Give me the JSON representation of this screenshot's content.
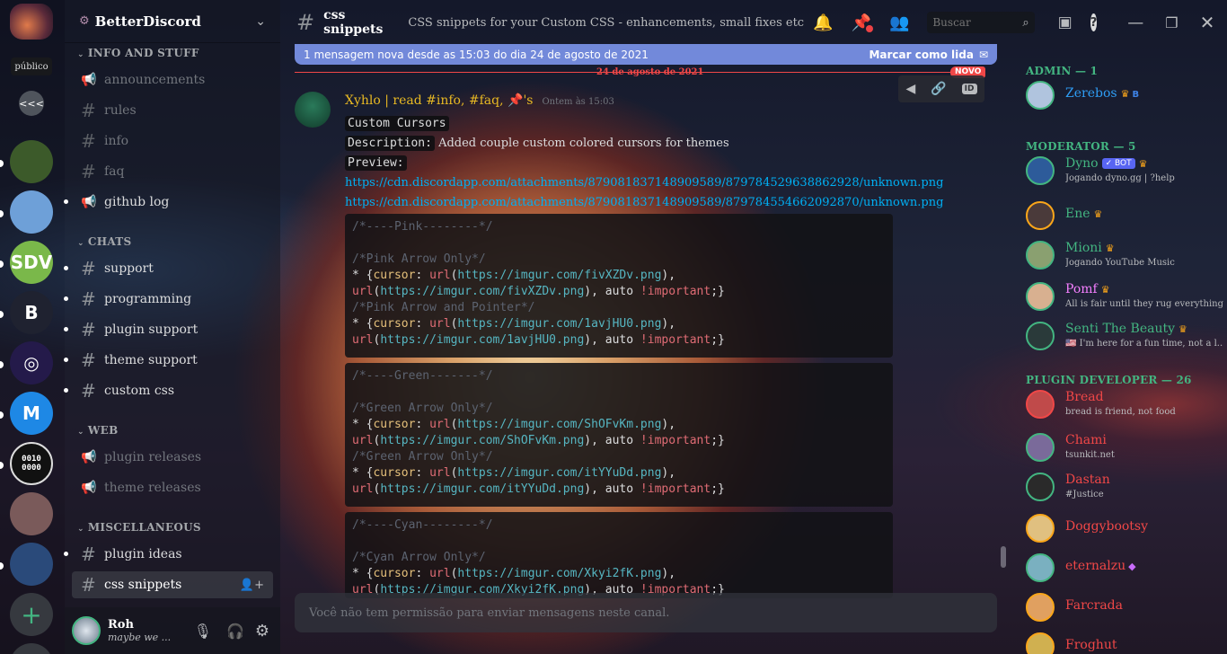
{
  "server": {
    "name": "BetterDiscord",
    "tooltip": "público",
    "collapse_label": "<<<",
    "add_icon": "plus-icon",
    "icons": [
      {
        "name": "server-space",
        "text": "",
        "color": "#5b3a4a"
      },
      {
        "name": "server-daisy",
        "text": "",
        "color": "#3c5a2a"
      },
      {
        "name": "server-bird",
        "text": "",
        "color": "#6ea0d8"
      },
      {
        "name": "server-sdv",
        "text": "SDV",
        "color": "#7ab84a"
      },
      {
        "name": "server-bd",
        "text": "B",
        "color": "#1f2230"
      },
      {
        "name": "server-spiral",
        "text": "◎",
        "color": "#241a4a"
      },
      {
        "name": "server-m",
        "text": "M",
        "color": "#1e88e5"
      },
      {
        "name": "server-binary",
        "text": "0010\n0000",
        "color": "#111"
      },
      {
        "name": "server-anime",
        "text": "",
        "color": "#7a5a5a"
      },
      {
        "name": "server-blue",
        "text": "",
        "color": "#2a4a7a"
      }
    ]
  },
  "sidebar": {
    "categories": [
      {
        "label": "INFO AND STUFF",
        "channels": [
          {
            "label": "announcements",
            "icon": "megaphone-icon",
            "muted": true
          },
          {
            "label": "rules",
            "icon": "hash-icon",
            "muted": true
          },
          {
            "label": "info",
            "icon": "hash-icon",
            "muted": true
          },
          {
            "label": "faq",
            "icon": "hash-icon",
            "muted": true
          },
          {
            "label": "github log",
            "icon": "megaphone-icon",
            "muted": false
          }
        ]
      },
      {
        "label": "CHATS",
        "channels": [
          {
            "label": "support",
            "icon": "hash-icon",
            "muted": false
          },
          {
            "label": "programming",
            "icon": "hash-icon",
            "muted": false
          },
          {
            "label": "plugin support",
            "icon": "hash-icon",
            "muted": false
          },
          {
            "label": "theme support",
            "icon": "hash-icon",
            "muted": false
          },
          {
            "label": "custom css",
            "icon": "hash-icon",
            "muted": false
          }
        ]
      },
      {
        "label": "WEB",
        "channels": [
          {
            "label": "plugin releases",
            "icon": "megaphone-icon",
            "muted": true
          },
          {
            "label": "theme releases",
            "icon": "megaphone-icon",
            "muted": true
          }
        ]
      },
      {
        "label": "MISCELLANEOUS",
        "channels": [
          {
            "label": "plugin ideas",
            "icon": "hash-icon",
            "muted": false
          },
          {
            "label": "css snippets",
            "icon": "hash-icon",
            "muted": false,
            "selected": true
          }
        ]
      }
    ]
  },
  "user_panel": {
    "name": "Roh",
    "status": "maybe we ..."
  },
  "header": {
    "channel": "css snippets",
    "topic": "CSS snippets for your Custom CSS - enhancements, small fixes etc",
    "search_placeholder": "Buscar"
  },
  "new_messages_bar": {
    "text": "1 mensagem nova desde as 15:03 do dia 24 de agosto de 2021",
    "action": "Marcar como lida"
  },
  "divider": {
    "date": "24 de agosto de 2021",
    "badge": "NOVO"
  },
  "message": {
    "author": "Xyhlo | read #info, #faq, 📌's",
    "timestamp": "Ontem às 15:03",
    "line1": "Custom Cursors",
    "line2_label": "Description:",
    "line2_text": "Added couple custom colored cursors for themes",
    "line3": "Preview:",
    "link1": "https://cdn.discordapp.com/attachments/879081837148909589/879784529638862928/unknown.png",
    "link2": "https://cdn.discordapp.com/attachments/879081837148909589/879784554662092870/unknown.png"
  },
  "code_blocks": [
    {
      "lines": [
        {
          "t": "/*----Pink--------*/",
          "c": "cm"
        },
        {
          "t": "",
          "c": ""
        },
        {
          "t": "/*Pink Arrow Only*/",
          "c": "cm"
        },
        {
          "t": "* {",
          "c": "mix",
          "parts": [
            [
              "* {",
              ""
            ],
            [
              "cursor",
              ":kw"
            ],
            [
              ": ",
              ""
            ],
            [
              "url",
              "fn"
            ],
            [
              "(",
              ""
            ],
            [
              "https://imgur.com/fivXZDv.png",
              "url"
            ],
            [
              "),",
              ""
            ]
          ]
        },
        {
          "t": "",
          "c": "mix",
          "parts": [
            [
              "url",
              "fn"
            ],
            [
              "(",
              ""
            ],
            [
              "https://imgur.com/fivXZDv.png",
              "url"
            ],
            [
              "), auto ",
              ""
            ],
            [
              "!important",
              "imp"
            ],
            [
              ";}",
              ""
            ]
          ]
        },
        {
          "t": "/*Pink Arrow and Pointer*/",
          "c": "cm"
        },
        {
          "t": "",
          "c": "mix",
          "parts": [
            [
              "* {",
              ""
            ],
            [
              "cursor",
              "kw"
            ],
            [
              ": ",
              ""
            ],
            [
              "url",
              "fn"
            ],
            [
              "(",
              ""
            ],
            [
              "https://imgur.com/1avjHU0.png",
              "url"
            ],
            [
              "),",
              ""
            ]
          ]
        },
        {
          "t": "",
          "c": "mix",
          "parts": [
            [
              "url",
              "fn"
            ],
            [
              "(",
              ""
            ],
            [
              "https://imgur.com/1avjHU0.png",
              "url"
            ],
            [
              "), auto ",
              ""
            ],
            [
              "!important",
              "imp"
            ],
            [
              ";}",
              ""
            ]
          ]
        }
      ]
    },
    {
      "lines": [
        {
          "t": "/*----Green-------*/",
          "c": "cm"
        },
        {
          "t": "",
          "c": ""
        },
        {
          "t": "/*Green Arrow Only*/",
          "c": "cm"
        },
        {
          "t": "",
          "c": "mix",
          "parts": [
            [
              "* {",
              ""
            ],
            [
              "cursor",
              "kw"
            ],
            [
              ": ",
              ""
            ],
            [
              "url",
              "fn"
            ],
            [
              "(",
              ""
            ],
            [
              "https://imgur.com/ShOFvKm.png",
              "url"
            ],
            [
              "),",
              ""
            ]
          ]
        },
        {
          "t": "",
          "c": "mix",
          "parts": [
            [
              "url",
              "fn"
            ],
            [
              "(",
              ""
            ],
            [
              "https://imgur.com/ShOFvKm.png",
              "url"
            ],
            [
              "), auto ",
              ""
            ],
            [
              "!important",
              "imp"
            ],
            [
              ";}",
              ""
            ]
          ]
        },
        {
          "t": "/*Green Arrow Only*/",
          "c": "cm"
        },
        {
          "t": "",
          "c": "mix",
          "parts": [
            [
              "* {",
              ""
            ],
            [
              "cursor",
              "kw"
            ],
            [
              ": ",
              ""
            ],
            [
              "url",
              "fn"
            ],
            [
              "(",
              ""
            ],
            [
              "https://imgur.com/itYYuDd.png",
              "url"
            ],
            [
              "),",
              ""
            ]
          ]
        },
        {
          "t": "",
          "c": "mix",
          "parts": [
            [
              "url",
              "fn"
            ],
            [
              "(",
              ""
            ],
            [
              "https://imgur.com/itYYuDd.png",
              "url"
            ],
            [
              "), auto ",
              ""
            ],
            [
              "!important",
              "imp"
            ],
            [
              ";}",
              ""
            ]
          ]
        }
      ]
    },
    {
      "lines": [
        {
          "t": "/*----Cyan--------*/",
          "c": "cm"
        },
        {
          "t": "",
          "c": ""
        },
        {
          "t": "/*Cyan Arrow Only*/",
          "c": "cm"
        },
        {
          "t": "",
          "c": "mix",
          "parts": [
            [
              "* {",
              ""
            ],
            [
              "cursor",
              "kw"
            ],
            [
              ": ",
              ""
            ],
            [
              "url",
              "fn"
            ],
            [
              "(",
              ""
            ],
            [
              "https://imgur.com/Xkyi2fK.png",
              "url"
            ],
            [
              "),",
              ""
            ]
          ]
        },
        {
          "t": "",
          "c": "mix",
          "parts": [
            [
              "url",
              "fn"
            ],
            [
              "(",
              ""
            ],
            [
              "https://imgur.com/Xkyi2fK.png",
              "url"
            ],
            [
              "), auto ",
              ""
            ],
            [
              "!important",
              "imp"
            ],
            [
              ";}",
              ""
            ]
          ]
        }
      ]
    }
  ],
  "composer": {
    "placeholder": "Você não tem permissão para enviar mensagens neste canal."
  },
  "members": {
    "groups": [
      {
        "role": "ADMIN — 1",
        "members": [
          {
            "name": "Zerebos",
            "status": "",
            "color": "#2f9df4",
            "badge": "👑"
          }
        ]
      },
      {
        "role": "MODERATOR — 5",
        "members": [
          {
            "name": "Dyno",
            "status": "Jogando dyno.gg | ?help",
            "color": "#43b581",
            "bot": "✓ BOT",
            "badge": "👑"
          },
          {
            "name": "Ene",
            "status": "",
            "color": "#43b581",
            "badge": "👑"
          },
          {
            "name": "Mioni",
            "status": "Jogando YouTube Music",
            "color": "#43b581",
            "badge": "👑"
          },
          {
            "name": "Pomf",
            "status": "All is fair until they rug everything ...",
            "color": "#f47fff",
            "badge": "👑"
          },
          {
            "name": "Senti The Beauty",
            "status": "🇺🇸 I'm here for a fun time, not a l...",
            "color": "#43b581",
            "badge": "👑"
          }
        ]
      },
      {
        "role": "PLUGIN DEVELOPER — 26",
        "members": [
          {
            "name": "Bread",
            "status": "bread is friend, not food",
            "color": "#f04747"
          },
          {
            "name": "Chami",
            "status": "tsunkit.net",
            "color": "#f04747"
          },
          {
            "name": "Dastan",
            "status": "#Justice",
            "color": "#f04747"
          },
          {
            "name": "Doggybootsy",
            "status": "",
            "color": "#f04747"
          },
          {
            "name": "eternalzu",
            "status": "",
            "color": "#f04747"
          },
          {
            "name": "Farcrada",
            "status": "",
            "color": "#f04747"
          },
          {
            "name": "Froghut",
            "status": "",
            "color": "#f04747"
          }
        ]
      }
    ]
  }
}
